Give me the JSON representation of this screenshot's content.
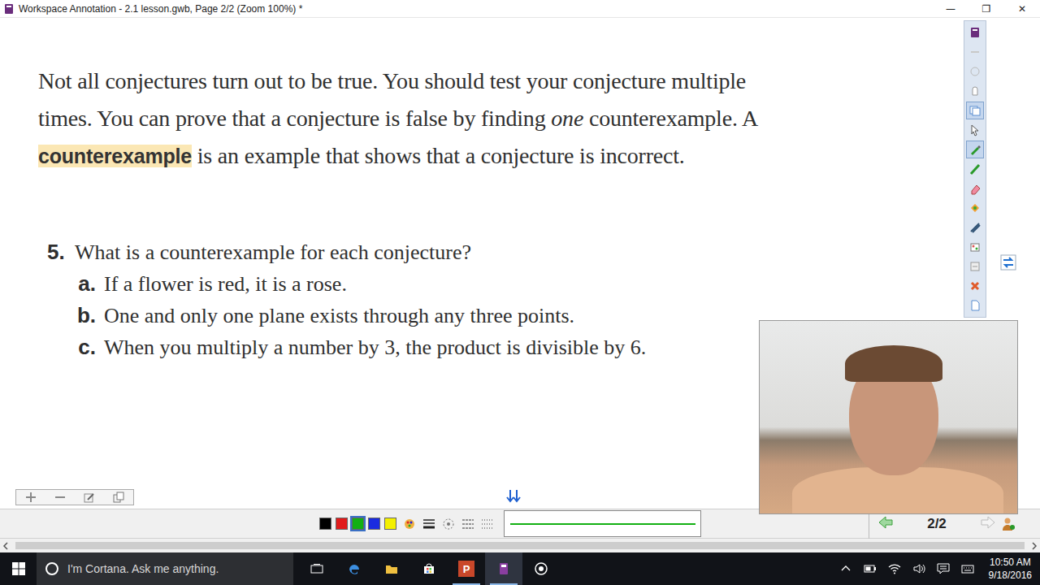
{
  "window": {
    "title": "Workspace Annotation - 2.1 lesson.gwb, Page 2/2 (Zoom 100%) *",
    "controls": [
      "—",
      "❐",
      "✕"
    ]
  },
  "page": {
    "paragraph": [
      [
        {
          "text": "Not all conjectures turn out to be true. You should test your conjecture multiple",
          "kind": "plain"
        }
      ],
      [
        {
          "text": "times. You can prove that a conjecture is false by finding ",
          "kind": "plain"
        },
        {
          "text": "one",
          "kind": "italic"
        },
        {
          "text": " counterexample. A",
          "kind": "plain"
        }
      ],
      [
        {
          "text": "counterexample",
          "kind": "highlight"
        },
        {
          "text": " is an example that shows that a conjecture is incorrect.",
          "kind": "plain"
        }
      ]
    ],
    "question": {
      "number": "5.",
      "prompt": "What is a counterexample for each conjecture?",
      "items": [
        {
          "label": "a.",
          "text": "If a flower is red, it is a rose."
        },
        {
          "label": "b.",
          "text": "One and only one plane exists through any three points."
        },
        {
          "label": "c.",
          "text": "When you multiply a number by 3, the product is divisible by 6."
        }
      ]
    }
  },
  "toolbar": {
    "tools": [
      {
        "selected": false
      },
      {
        "selected": false
      },
      {
        "selected": false
      },
      {
        "selected": false
      },
      {
        "selected": true
      },
      {
        "selected": false
      },
      {
        "selected": true
      },
      {
        "selected": false
      },
      {
        "selected": false
      },
      {
        "selected": false
      },
      {
        "selected": false
      },
      {
        "selected": false
      },
      {
        "selected": false
      },
      {
        "selected": false
      },
      {
        "selected": false
      }
    ]
  },
  "palette": [
    {
      "color": "#000000",
      "selected": false
    },
    {
      "color": "#e01c1c",
      "selected": false
    },
    {
      "color": "#12b012",
      "selected": true
    },
    {
      "color": "#1a2be0",
      "selected": false
    },
    {
      "color": "#f4f000",
      "selected": false
    }
  ],
  "nav": {
    "page": "2/2",
    "prev": {
      "disabled": false
    },
    "next": {
      "disabled": true
    }
  },
  "taskbar": {
    "search": {
      "placeholder": "I'm Cortana. Ask me anything."
    },
    "apps": [
      {
        "kind": "taskview",
        "running": false,
        "selected": false
      },
      {
        "kind": "edge",
        "running": false,
        "selected": false
      },
      {
        "kind": "explorer",
        "running": false,
        "selected": false
      },
      {
        "kind": "store",
        "running": false,
        "selected": false
      },
      {
        "kind": "powerpoint",
        "glyph": "P",
        "running": true,
        "selected": false
      },
      {
        "kind": "workspace",
        "running": true,
        "selected": true
      },
      {
        "kind": "recorder",
        "running": false,
        "selected": false
      }
    ],
    "clock": {
      "time": "10:50 AM",
      "date": "9/18/2016"
    }
  }
}
